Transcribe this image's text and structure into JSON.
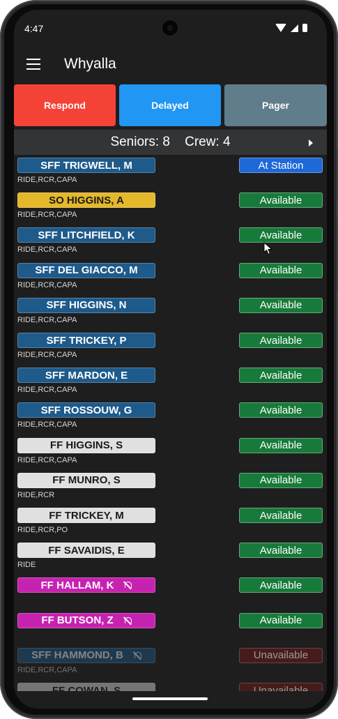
{
  "status_bar": {
    "time": "4:47"
  },
  "app_bar": {
    "title": "Whyalla"
  },
  "actions": [
    {
      "label": "Respond",
      "color": "#f44336"
    },
    {
      "label": "Delayed",
      "color": "#2196f3"
    },
    {
      "label": "Pager",
      "color": "#607d8b"
    }
  ],
  "counts": {
    "text": "Seniors: 8    Crew: 4"
  },
  "colors": {
    "senior": "#1e5a8a",
    "officer": "#e5b82a",
    "crew": "#e0e0e0",
    "pager_off": "#c622b0",
    "at_station": "#1e68d8",
    "available": "#187a3a",
    "unavailable": "#6b1a1a"
  },
  "members": [
    {
      "name": "SFF TRIGWELL, M",
      "quals": "RIDE,RCR,CAPA",
      "status": "At Station",
      "role": "senior",
      "status_type": "at_station",
      "pager_off": false
    },
    {
      "name": "SO HIGGINS, A",
      "quals": "RIDE,RCR,CAPA",
      "status": "Available",
      "role": "officer",
      "status_type": "available",
      "pager_off": false
    },
    {
      "name": "SFF LITCHFIELD, K",
      "quals": "RIDE,RCR,CAPA",
      "status": "Available",
      "role": "senior",
      "status_type": "available",
      "pager_off": false
    },
    {
      "name": "SFF DEL GIACCO, M",
      "quals": "RIDE,RCR,CAPA",
      "status": "Available",
      "role": "senior",
      "status_type": "available",
      "pager_off": false
    },
    {
      "name": "SFF HIGGINS, N",
      "quals": "RIDE,RCR,CAPA",
      "status": "Available",
      "role": "senior",
      "status_type": "available",
      "pager_off": false
    },
    {
      "name": "SFF TRICKEY, P",
      "quals": "RIDE,RCR,CAPA",
      "status": "Available",
      "role": "senior",
      "status_type": "available",
      "pager_off": false
    },
    {
      "name": "SFF MARDON, E",
      "quals": "RIDE,RCR,CAPA",
      "status": "Available",
      "role": "senior",
      "status_type": "available",
      "pager_off": false
    },
    {
      "name": "SFF ROSSOUW, G",
      "quals": "RIDE,RCR,CAPA",
      "status": "Available",
      "role": "senior",
      "status_type": "available",
      "pager_off": false
    },
    {
      "name": "FF HIGGINS, S",
      "quals": "RIDE,RCR,CAPA",
      "status": "Available",
      "role": "crew",
      "status_type": "available",
      "pager_off": false
    },
    {
      "name": "FF MUNRO, S",
      "quals": "RIDE,RCR",
      "status": "Available",
      "role": "crew",
      "status_type": "available",
      "pager_off": false
    },
    {
      "name": "FF TRICKEY, M",
      "quals": "RIDE,RCR,PO",
      "status": "Available",
      "role": "crew",
      "status_type": "available",
      "pager_off": false
    },
    {
      "name": "FF SAVAIDIS, E",
      "quals": "RIDE",
      "status": "Available",
      "role": "crew",
      "status_type": "available",
      "pager_off": false
    },
    {
      "name": "FF HALLAM, K",
      "quals": "",
      "status": "Available",
      "role": "pager_off",
      "status_type": "available",
      "pager_off": true
    },
    {
      "name": "FF BUTSON, Z",
      "quals": "",
      "status": "Available",
      "role": "pager_off",
      "status_type": "available",
      "pager_off": true
    },
    {
      "name": "SFF HAMMOND, B",
      "quals": "RIDE,RCR,CAPA",
      "status": "Unavailable",
      "role": "senior_dim",
      "status_type": "unavailable",
      "pager_off": true
    },
    {
      "name": "FF COWAN, S",
      "quals": "",
      "status": "Unavailable",
      "role": "crew_dim",
      "status_type": "unavailable",
      "pager_off": false
    }
  ]
}
